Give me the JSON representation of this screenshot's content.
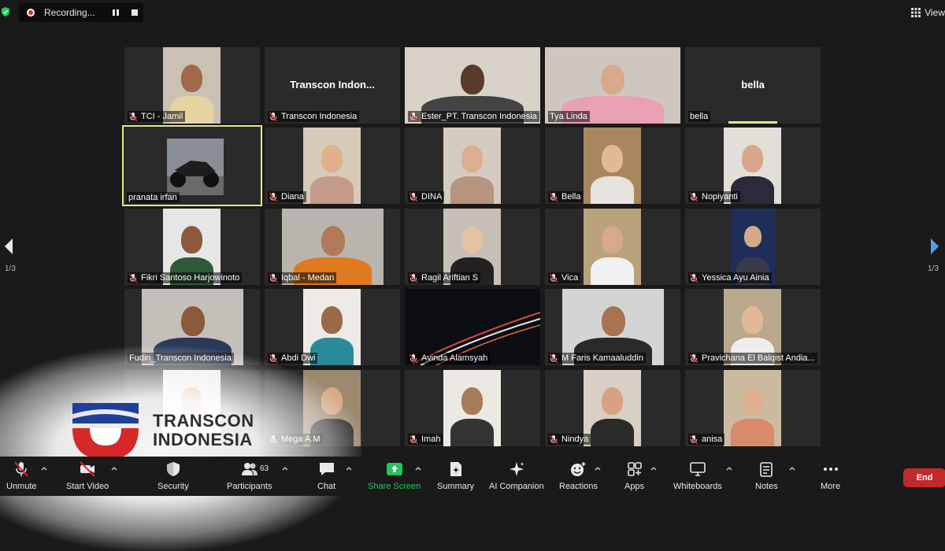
{
  "recording": {
    "label": "Recording..."
  },
  "view": {
    "label": "View"
  },
  "pagination": {
    "left": "1/3",
    "right": "1/3"
  },
  "participants": [
    {
      "name": "TCI - Jamil",
      "muted": true
    },
    {
      "name": "Transcon Indonesia",
      "muted": true,
      "display_name": "Transcon  Indon..."
    },
    {
      "name": "Ester_PT. Transcon Indonesia",
      "muted": true
    },
    {
      "name": "Tya Linda",
      "muted": false
    },
    {
      "name": "bella",
      "muted": false,
      "display_name": "bella"
    },
    {
      "name": "pranata irfan",
      "muted": false,
      "active": true
    },
    {
      "name": "Diana",
      "muted": true
    },
    {
      "name": "DINA",
      "muted": true
    },
    {
      "name": "Bella",
      "muted": true
    },
    {
      "name": "Nopiyanti",
      "muted": true
    },
    {
      "name": "Fikri Santoso Harjowinoto",
      "muted": true
    },
    {
      "name": "Iqbal - Medan",
      "muted": true
    },
    {
      "name": "Ragil Ariftian S",
      "muted": true
    },
    {
      "name": "Vica",
      "muted": true
    },
    {
      "name": "Yessica Ayu Ainia",
      "muted": true
    },
    {
      "name": "Fudin_Transcon Indonesia",
      "muted": false
    },
    {
      "name": "Abdi Dwi",
      "muted": true
    },
    {
      "name": "Avinda Alamsyah",
      "muted": true
    },
    {
      "name": "M Faris Kamaaluddin",
      "muted": true
    },
    {
      "name": "Pravichana El Balqist Andia...",
      "muted": true
    },
    {
      "name": "",
      "muted": false
    },
    {
      "name": "Mega A.M",
      "muted": true
    },
    {
      "name": "Imah",
      "muted": true
    },
    {
      "name": "Nindya",
      "muted": true
    },
    {
      "name": "anisa",
      "muted": true
    }
  ],
  "logo": {
    "line1": "TRANSCON",
    "line2": "INDONESIA"
  },
  "toolbar": {
    "unmute": "Unmute",
    "start_video": "Start Video",
    "security": "Security",
    "participants": "Participants",
    "participants_count": "63",
    "chat": "Chat",
    "share_screen": "Share Screen",
    "summary": "Summary",
    "ai_companion": "AI Companion",
    "reactions": "Reactions",
    "apps": "Apps",
    "whiteboards": "Whiteboards",
    "notes": "Notes",
    "more": "More",
    "end": "End"
  },
  "colors": {
    "background": "#1a1a1a",
    "tile": "#2a2a2a",
    "active_border": "#e6e68a",
    "share_green": "#22c55e",
    "end_red": "#c22a2a",
    "muted_red": "#e02828"
  }
}
